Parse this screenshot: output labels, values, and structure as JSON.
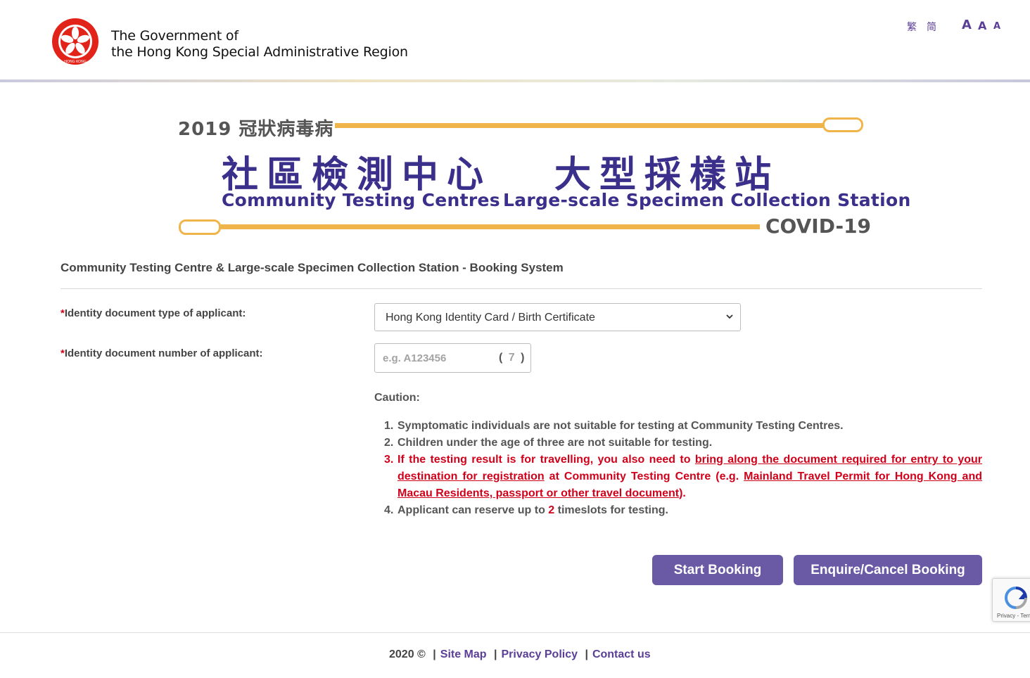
{
  "header": {
    "gov_line1": "The Government of",
    "gov_line2": "the Hong Kong Special Administrative Region",
    "emblem_label": "HONG KONG",
    "lang_tc": "繁",
    "lang_sc": "简",
    "font_large": "A",
    "font_medium": "A",
    "font_small": "A"
  },
  "banner": {
    "year_label": "2019 冠狀病毒病",
    "title_zh_1": "社區檢測中心",
    "title_zh_2": "大型採樣站",
    "title_en_1": "Community Testing Centres",
    "title_en_2": "Large-scale Specimen Collection Station",
    "covid_label": "COVID-19"
  },
  "form": {
    "system_title": "Community Testing Centre & Large-scale Specimen Collection Station - Booking System",
    "required_mark": "*",
    "doc_type_label": "Identity document type of applicant:",
    "doc_type_value": "Hong Kong Identity Card / Birth Certificate",
    "doc_number_label": "Identity document number of applicant:",
    "doc_number_placeholder": "e.g. A123456",
    "check_digit_open": "(",
    "check_digit": "7",
    "check_digit_close": ")"
  },
  "caution": {
    "title": "Caution:",
    "item1_num": "1.",
    "item1": "Symptomatic individuals are not suitable for testing at Community Testing Centres.",
    "item2_num": "2.",
    "item2": "Children under the age of three are not suitable for testing.",
    "item3_num": "3.",
    "item3_a": "If the testing result is for travelling, you also need to ",
    "item3_link1": "bring along the document required for entry to your destination for registration",
    "item3_b": " at Community Testing Centre (e.g. ",
    "item3_link2": "Mainland Travel Permit for Hong Kong and Macau Residents, passport or other travel document",
    "item3_c": ").",
    "item4_num": "4.",
    "item4_a": "Applicant can reserve up to ",
    "item4_count": "2",
    "item4_b": " timeslots for testing."
  },
  "buttons": {
    "start": "Start Booking",
    "enquire": "Enquire/Cancel Booking"
  },
  "recaptcha": {
    "text": "Privacy - Terms"
  },
  "footer": {
    "copyright": "2020 ©",
    "sep": "|",
    "site_map": "Site Map",
    "privacy": "Privacy Policy",
    "contact": "Contact us"
  },
  "colors": {
    "brand_purple": "#5b3e96",
    "button_purple": "#6a5aa6",
    "banner_navy": "#3a2f8a",
    "banner_gold": "#efb54a",
    "alert_red": "#d0021b"
  }
}
